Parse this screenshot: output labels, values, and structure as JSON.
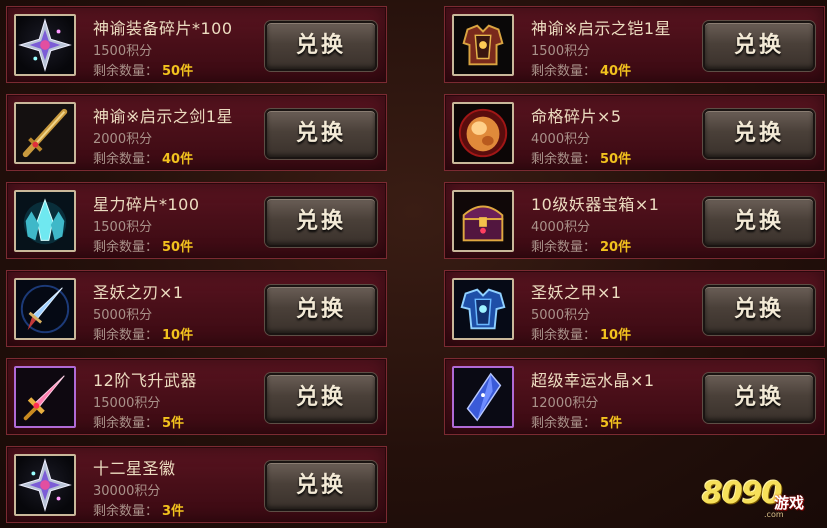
{
  "exchange_label": "兑换",
  "remaining_label": "剩余数量：",
  "points_unit": "积分",
  "items": [
    {
      "name": "神谕装备碎片*100",
      "points": "1500积分",
      "qty": "50件",
      "icon": "shuriken-crystal-icon"
    },
    {
      "name": "神谕※启示之铠1星",
      "points": "1500积分",
      "qty": "40件",
      "icon": "armor-icon"
    },
    {
      "name": "神谕※启示之剑1星",
      "points": "2000积分",
      "qty": "40件",
      "icon": "sword-icon"
    },
    {
      "name": "命格碎片×5",
      "points": "4000积分",
      "qty": "50件",
      "icon": "amber-gem-icon"
    },
    {
      "name": "星力碎片*100",
      "points": "1500积分",
      "qty": "50件",
      "icon": "ice-crystal-icon"
    },
    {
      "name": "10级妖器宝箱×1",
      "points": "4000积分",
      "qty": "20件",
      "icon": "treasure-chest-icon"
    },
    {
      "name": "圣妖之刃×1",
      "points": "5000积分",
      "qty": "10件",
      "icon": "blade-icon"
    },
    {
      "name": "圣妖之甲×1",
      "points": "5000积分",
      "qty": "10件",
      "icon": "blue-armor-icon"
    },
    {
      "name": "12阶飞升武器",
      "points": "15000积分",
      "qty": "5件",
      "icon": "golden-sword-icon"
    },
    {
      "name": "超级幸运水晶×1",
      "points": "12000积分",
      "qty": "5件",
      "icon": "blue-crystal-icon"
    },
    {
      "name": "十二星圣徽",
      "points": "30000积分",
      "qty": "3件",
      "icon": "star-emblem-icon"
    }
  ],
  "watermark": {
    "digits": "8090",
    "word": "游戏",
    "domain": ".com"
  }
}
